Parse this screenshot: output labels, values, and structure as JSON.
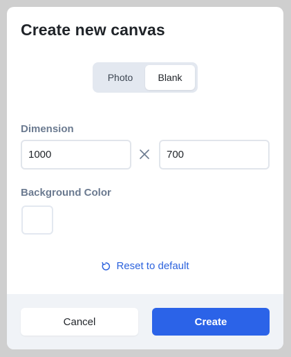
{
  "dialog": {
    "title": "Create new canvas",
    "tabs": [
      {
        "label": "Photo",
        "active": false
      },
      {
        "label": "Blank",
        "active": true
      }
    ],
    "dimension": {
      "label": "Dimension",
      "width": "1000",
      "height": "700",
      "separator_icon": "times-icon"
    },
    "background": {
      "label": "Background Color",
      "color": "#ffffff"
    },
    "reset_label": "Reset to default",
    "reset_icon": "reset-icon",
    "cancel_label": "Cancel",
    "create_label": "Create"
  },
  "colors": {
    "accent": "#2b63e8",
    "link": "#2b62dd",
    "label": "#6b7a90",
    "footer_bg": "#f0f3f7"
  }
}
